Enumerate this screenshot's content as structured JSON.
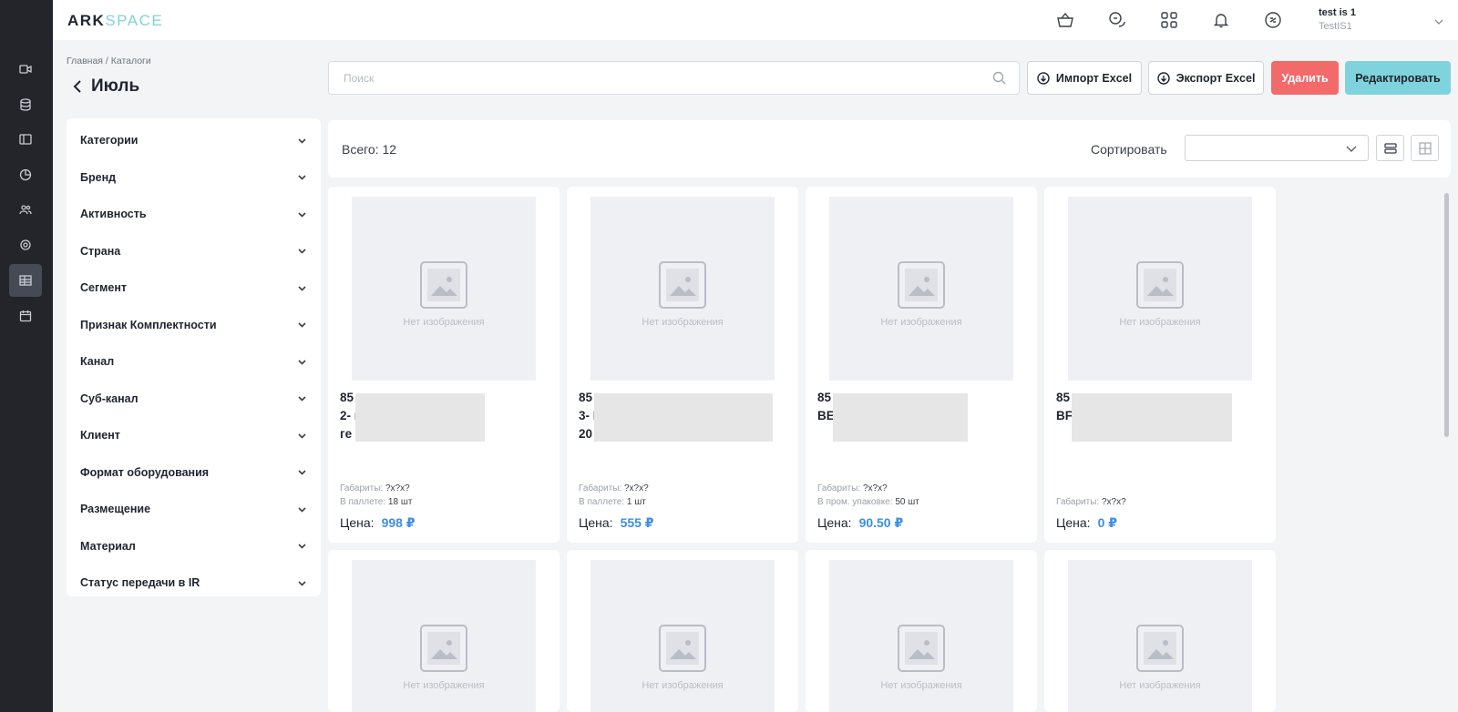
{
  "app": {
    "logo_part1": "ARK",
    "logo_part2": "SPACE"
  },
  "user": {
    "name": "test is 1",
    "login": "TestIS1"
  },
  "breadcrumb": "Главная / Каталоги",
  "page_title": "Июль",
  "toolbar": {
    "search_placeholder": "Поиск",
    "import_label": "Импорт Excel",
    "export_label": "Экспорт Excel",
    "delete_label": "Удалить",
    "edit_label": "Редактировать"
  },
  "filters": [
    {
      "label": "Категории"
    },
    {
      "label": "Бренд"
    },
    {
      "label": "Активность"
    },
    {
      "label": "Страна"
    },
    {
      "label": "Сегмент"
    },
    {
      "label": "Признак Комплектности"
    },
    {
      "label": "Канал"
    },
    {
      "label": "Суб-канал"
    },
    {
      "label": "Клиент"
    },
    {
      "label": "Формат оборудования"
    },
    {
      "label": "Размещение"
    },
    {
      "label": "Материал"
    },
    {
      "label": "Статус передачи в IR"
    }
  ],
  "summary": {
    "total": "Всего: 12",
    "sort_label": "Сортировать"
  },
  "no_image_text": "Нет изображения",
  "products": [
    {
      "title": "85\n2-                                    над\nге",
      "dim_label": "Габариты:",
      "dim_value": "?x?x?",
      "pack_label": "В паллете:",
      "pack_value": "18 шт",
      "price_label": "Цена:",
      "price_value": "998 ₽"
    },
    {
      "title": "85\n3-                                    NY\n20",
      "dim_label": "Габариты:",
      "dim_value": "?x?x?",
      "pack_label": "В паллете:",
      "pack_value": "1 шт",
      "price_label": "Цена:",
      "price_value": "555 ₽"
    },
    {
      "title": "85\nBE",
      "dim_label": "Габариты:",
      "dim_value": "?x?x?",
      "pack_label": "В пром. упаковке:",
      "pack_value": "50 шт",
      "price_label": "Цена:",
      "price_value": "90.50 ₽"
    },
    {
      "title": "85\nBF                                    мбо",
      "dim_label": "Габариты:",
      "dim_value": "?x?x?",
      "pack_label": "",
      "pack_value": "",
      "price_label": "Цена:",
      "price_value": "0 ₽"
    }
  ],
  "icons": {
    "rail": [
      "video-icon",
      "database-icon",
      "layout-icon",
      "chart-pie-icon",
      "users-icon",
      "settings-icon",
      "catalog-icon",
      "calendar-icon"
    ],
    "top": [
      "basket-icon",
      "chat-icon",
      "apps-grid-icon",
      "bell-icon",
      "sync-icon"
    ]
  }
}
